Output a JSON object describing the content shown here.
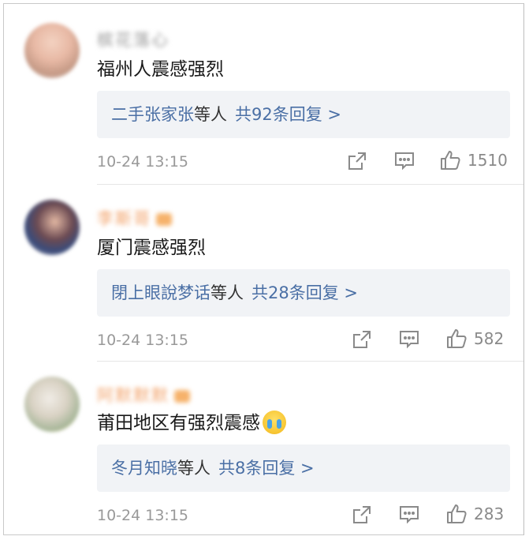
{
  "colors": {
    "link": "#4a6fa5",
    "reply_box_bg": "#f1f3f6",
    "meta_gray": "#999999",
    "text_dark": "#1a1a1a"
  },
  "comments": [
    {
      "username": "槟花落心",
      "text": "福州人震感强烈",
      "reply_names": "二手张家张",
      "reply_mid": "等人",
      "reply_count": "共92条回复 >",
      "timestamp": "10-24 13:15",
      "likes": "1510",
      "emoji": ""
    },
    {
      "username": "李斯哥",
      "text": "厦门震感强烈",
      "reply_names": "閉上眼說梦话",
      "reply_mid": "等人",
      "reply_count": "共28条回复 >",
      "timestamp": "10-24 13:15",
      "likes": "582",
      "emoji": ""
    },
    {
      "username": "阿默默默",
      "text": "莆田地区有强烈震感",
      "reply_names": "冬月知晓",
      "reply_mid": "等人",
      "reply_count": "共8条回复 >",
      "timestamp": "10-24 13:15",
      "likes": "283",
      "emoji": "crying-face-emoji"
    }
  ]
}
